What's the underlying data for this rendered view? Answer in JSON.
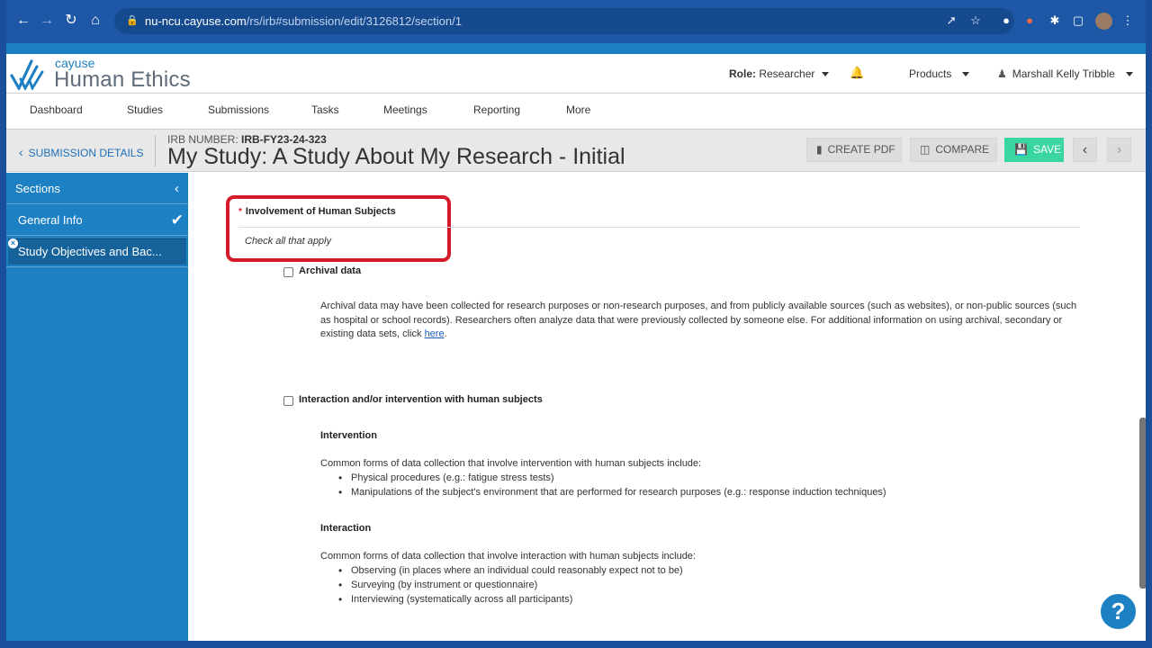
{
  "browser": {
    "url_host": "nu-ncu.cayuse.com",
    "url_path": "/rs/irb#submission/edit/3126812/section/1"
  },
  "app": {
    "logo_small": "cayuse",
    "logo_big": "Human Ethics",
    "role_label": "Role:",
    "role_value": "Researcher",
    "products": "Products",
    "user": "Marshall Kelly Tribble"
  },
  "nav": [
    "Dashboard",
    "Studies",
    "Submissions",
    "Tasks",
    "Meetings",
    "Reporting",
    "More"
  ],
  "submission": {
    "back_label": "SUBMISSION DETAILS",
    "irb_label": "IRB NUMBER:",
    "irb_number": "IRB-FY23-24-323",
    "title": "My Study: A Study About My Research - Initial",
    "create_pdf": "CREATE PDF",
    "compare": "COMPARE",
    "save": "SAVE"
  },
  "sidebar": {
    "header": "Sections",
    "items": [
      "General Info",
      "Study Objectives and Bac..."
    ]
  },
  "question": {
    "required_mark": "*",
    "title": "Involvement of Human Subjects",
    "hint": "Check all that apply",
    "options": [
      {
        "label": "Archival data",
        "description": "Archival data may have been collected for research purposes or non-research purposes, and from publicly available sources (such as websites), or non-public sources (such as hospital or school records). Researchers often analyze data that were previously collected by someone else. For additional information on using archival, secondary or existing data sets, click",
        "link": "here",
        "after_link": "."
      },
      {
        "label": "Interaction and/or intervention with human subjects",
        "intervention_title": "Intervention",
        "intervention_intro": "Common forms of data collection that involve intervention with human subjects include:",
        "intervention_items": [
          "Physical procedures (e.g.: fatigue stress tests)",
          "Manipulations of the subject's environment that are performed for research purposes (e.g.: response induction techniques)"
        ],
        "interaction_title": "Interaction",
        "interaction_intro": "Common forms of data collection that involve interaction with human subjects include:",
        "interaction_items": [
          "Observing (in places where an individual could reasonably expect not to be)",
          "Surveying (by instrument or questionnaire)",
          "Interviewing (systematically across all participants)"
        ]
      }
    ]
  },
  "help": "?",
  "colors": {
    "brand_blue": "#1d80c3",
    "highlight_red": "#d51a2a",
    "save_green": "#39d6a0"
  }
}
